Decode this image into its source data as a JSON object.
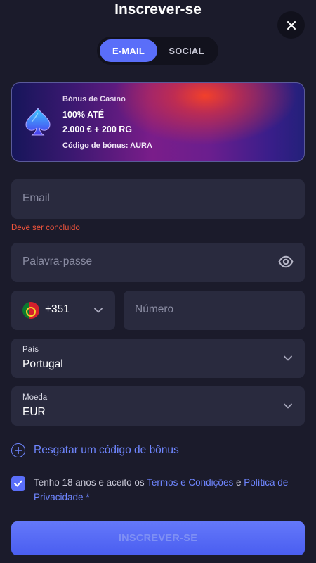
{
  "header": {
    "title": "Inscrever-se"
  },
  "tabs": [
    {
      "label": "E-MAIL",
      "active": true
    },
    {
      "label": "SOCIAL",
      "active": false
    }
  ],
  "banner": {
    "category": "Bónus de Casino",
    "line1": "100% ATÉ",
    "line2": "2.000 € + 200 RG",
    "code_label": "Código de bónus:",
    "code_value": "AURA",
    "icon": "spade-icon"
  },
  "form": {
    "email": {
      "placeholder": "Email",
      "value": "",
      "error": "Deve ser concluido"
    },
    "password": {
      "placeholder": "Palavra-passe",
      "value": ""
    },
    "phone": {
      "country_code": "+351",
      "flag": "portugal-flag-icon",
      "number_placeholder": "Número"
    },
    "country": {
      "label": "País",
      "value": "Portugal"
    },
    "currency": {
      "label": "Moeda",
      "value": "EUR"
    }
  },
  "promo": {
    "label": "Resgatar um código de bônus"
  },
  "terms": {
    "checked": true,
    "prefix": "Tenho 18 anos e aceito os",
    "terms_link": "Termos e Condições",
    "conjunction": "e",
    "privacy_link": "Política de Privacidade",
    "required_mark": "*"
  },
  "submit": {
    "label": "INSCREVER-SE"
  },
  "colors": {
    "background": "#1b1b2b",
    "field": "#292a3e",
    "accent": "#5a6ef9",
    "link": "#6f86ff",
    "error": "#f0543c"
  }
}
